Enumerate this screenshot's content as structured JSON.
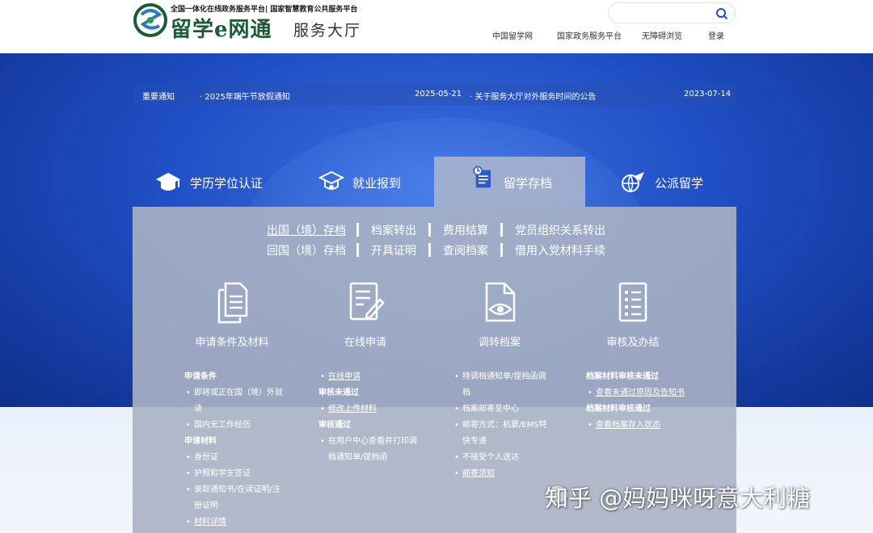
{
  "header": {
    "logo_top": "全国一体化在线政务服务平台| 国家智慧教育公共服务平台",
    "logo_name": "留学e网通",
    "logo_sub": "服务大厅",
    "search_placeholder": "",
    "nav": [
      "中国留学网",
      "国家政务服务平台",
      "无障碍浏览",
      "登录"
    ]
  },
  "notice": {
    "label": "重要通知",
    "items": [
      {
        "title": "· 2025年端午节放假通知",
        "date": "2025-05-21"
      },
      {
        "title": "· 关于服务大厅对外服务时间的公告",
        "date": "2023-07-14"
      }
    ]
  },
  "tabs": [
    {
      "label": "学历学位认证",
      "icon": "graduation-cap-icon"
    },
    {
      "label": "就业报到",
      "icon": "hat-badge-icon"
    },
    {
      "label": "留学存档",
      "icon": "archive-doc-icon",
      "active": true
    },
    {
      "label": "公派留学",
      "icon": "airplane-globe-icon"
    }
  ],
  "links": {
    "row1": [
      "出国（境）存档",
      "档案转出",
      "费用结算",
      "党员组织关系转出"
    ],
    "row2": [
      "回国（境）存档",
      "开具证明",
      "查阅档案",
      "借用入党材料手续"
    ]
  },
  "features": [
    {
      "label": "申请条件及材料",
      "icon": "documents-icon"
    },
    {
      "label": "在线申请",
      "icon": "edit-form-icon"
    },
    {
      "label": "调转档案",
      "icon": "view-file-icon"
    },
    {
      "label": "审核及办结",
      "icon": "checklist-icon"
    }
  ],
  "columns": {
    "c0": {
      "h1": "申请条件",
      "i1a": "即将或正在国（境）外就",
      "i1b": "读",
      "i2": "国内无工作经历",
      "h2": "申请材料",
      "i3": "身份证",
      "i4": "护照和学生签证",
      "i5a": "录取通知书/在读证明/注",
      "i5b": "册证明",
      "i6": "材料详情"
    },
    "c1": {
      "i1": "在线申请",
      "h1": "审核未通过",
      "i2": "修改上传材料",
      "h2": "审核通过",
      "i3a": "在用户中心查看并打印调",
      "i3b": "档通知单/提档函"
    },
    "c2": {
      "i1a": "持调档通知单/提档函调",
      "i1b": "档",
      "i2": "档案邮寄至中心",
      "i3a": "邮寄方式：机要/EMS特",
      "i3b": "快专递",
      "i4": "不接受个人送达",
      "i5": "邮寄须知"
    },
    "c3": {
      "h1": "档案材料审核未通过",
      "i1": "查看未通过原因及告知书",
      "h2": "档案材料审核通过",
      "i2": "查看档案存入状态"
    }
  },
  "watermark": "知乎 @妈妈咪呀意大利糖",
  "colors": {
    "banner": "#1f4fc4",
    "panel": "#aab2c4",
    "logo_green": "#1d5a3a"
  }
}
